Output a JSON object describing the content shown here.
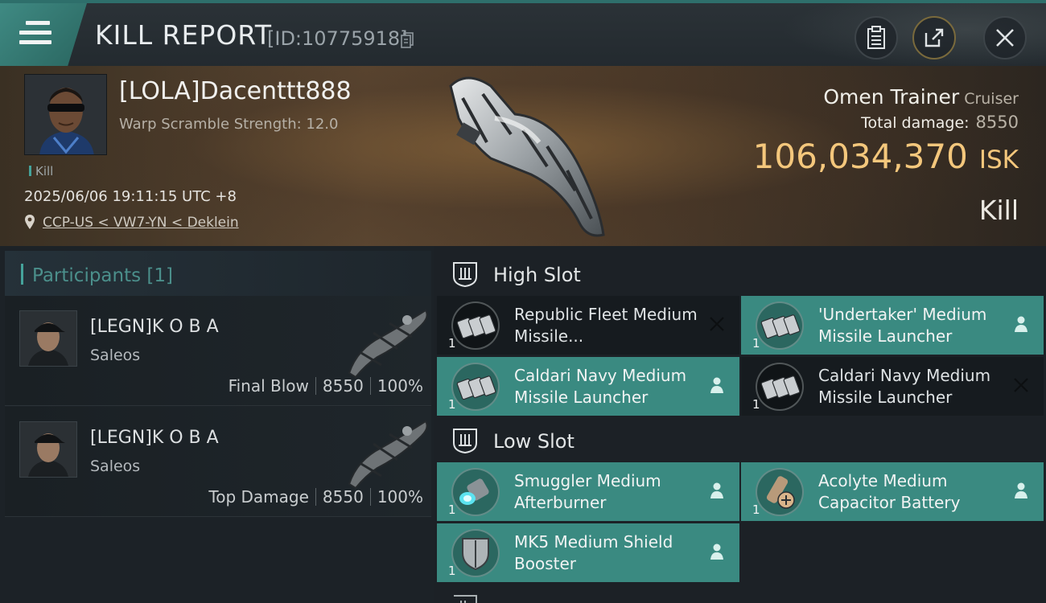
{
  "header": {
    "title": "KILL REPORT",
    "report_id": "[ID:10775918]"
  },
  "victim": {
    "pilot": "[LOLA]Dacenttt888",
    "warp_scramble": "Warp Scramble Strength: 12.0",
    "tag": "Kill",
    "datetime": "2025/06/06 19:11:15 UTC +8",
    "location": "CCP-US < VW7-YN < Deklein",
    "ship": "Omen Trainer",
    "ship_class": "Cruiser",
    "total_damage_label": "Total damage:",
    "total_damage": "8550",
    "isk_value": "106,034,370",
    "isk_unit": "ISK",
    "result": "Kill"
  },
  "participants": {
    "header": "Participants",
    "count": "[1]",
    "rows": [
      {
        "name": "[LEGN]K O B A",
        "ship": "Saleos",
        "role": "Final Blow",
        "damage": "8550",
        "percent": "100%"
      },
      {
        "name": "[LEGN]K O B A",
        "ship": "Saleos",
        "role": "Top Damage",
        "damage": "8550",
        "percent": "100%"
      }
    ]
  },
  "fitting": {
    "high_slot": {
      "label": "High Slot",
      "modules": [
        {
          "qty": "1",
          "name": "Republic Fleet Medium Missile...",
          "state": "destroyed"
        },
        {
          "qty": "1",
          "name": "'Undertaker' Medium Missile Launcher",
          "state": "dropped"
        },
        {
          "qty": "1",
          "name": "Caldari Navy Medium Missile Launcher",
          "state": "dropped"
        },
        {
          "qty": "1",
          "name": "Caldari Navy Medium Missile Launcher",
          "state": "destroyed"
        }
      ]
    },
    "low_slot": {
      "label": "Low Slot",
      "modules": [
        {
          "qty": "1",
          "name": "Smuggler Medium Afterburner",
          "state": "dropped"
        },
        {
          "qty": "1",
          "name": "Acolyte Medium Capacitor Battery",
          "state": "dropped"
        },
        {
          "qty": "1",
          "name": "MK5 Medium Shield Booster",
          "state": "dropped"
        }
      ]
    }
  },
  "colors": {
    "accent": "#3a8a81",
    "isk": "#f4c77c",
    "title_tab": "#3f8a83"
  },
  "icons": [
    "menu-icon",
    "copy-icon",
    "clipboard-icon",
    "share-icon",
    "close-icon",
    "location-pin-icon",
    "slot-icon",
    "person-icon",
    "x-mark-icon"
  ]
}
